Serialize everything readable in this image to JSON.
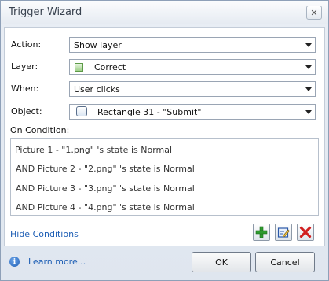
{
  "window": {
    "title": "Trigger Wizard",
    "close_glyph": "✕"
  },
  "form": {
    "action_label": "Action:",
    "action_value": "Show layer",
    "layer_label": "Layer:",
    "layer_value": "Correct",
    "when_label": "When:",
    "when_value": "User clicks",
    "object_label": "Object:",
    "object_value": "Rectangle 31 - \"Submit\""
  },
  "conditions": {
    "header": "On Condition:",
    "items": [
      "Picture 1 - \"1.png\" 's state is Normal",
      "AND Picture 2 - \"2.png\" 's state is Normal",
      "AND Picture 3 - \"3.png\" 's state is Normal",
      "AND Picture 4 - \"4.png\" 's state is Normal"
    ],
    "hide_link": "Hide Conditions"
  },
  "footer": {
    "learn_more": "Learn more...",
    "ok_label": "OK",
    "cancel_label": "Cancel"
  },
  "colors": {
    "link": "#1f5fb5",
    "add_icon": "#2e9a2e",
    "delete_icon": "#d11f1f"
  },
  "icons": [
    "close-icon",
    "dropdown-arrow-icon",
    "layer-icon",
    "rectangle-icon",
    "add-icon",
    "edit-icon",
    "delete-icon",
    "info-icon"
  ]
}
